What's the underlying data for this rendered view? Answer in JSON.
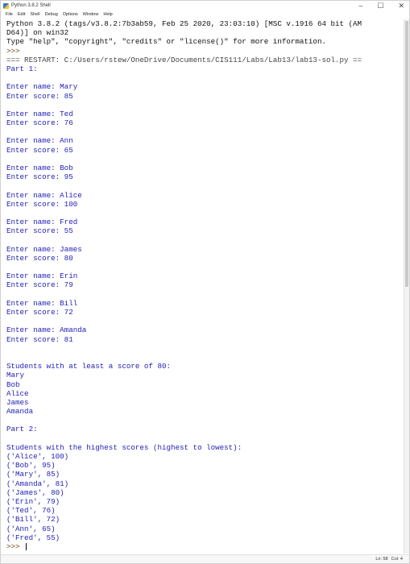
{
  "window": {
    "title": "Python 3.8.2 Shell",
    "icon": "python-icon",
    "controls": {
      "minimize": "–",
      "maximize": "☐",
      "close": "✕"
    }
  },
  "menu": [
    "File",
    "Edit",
    "Shell",
    "Debug",
    "Options",
    "Window",
    "Help"
  ],
  "shell_lines": [
    {
      "cls": "sys",
      "text": "Python 3.8.2 (tags/v3.8.2:7b3ab59, Feb 25 2020, 23:03:10) [MSC v.1916 64 bit (AM"
    },
    {
      "cls": "sys",
      "text": "D64)] on win32"
    },
    {
      "cls": "sys",
      "text": "Type \"help\", \"copyright\", \"credits\" or \"license()\" for more information."
    },
    {
      "cls": "prompt",
      "text": ">>> "
    },
    {
      "cls": "restart",
      "text": "=== RESTART: C:/Users/rstew/OneDrive/Documents/CIS111/Labs/Lab13/lab13-sol.py =="
    },
    {
      "cls": "out",
      "text": "Part 1:"
    },
    {
      "cls": "out",
      "text": ""
    },
    {
      "cls": "out",
      "text": "Enter name: Mary"
    },
    {
      "cls": "out",
      "text": "Enter score: 85"
    },
    {
      "cls": "out",
      "text": ""
    },
    {
      "cls": "out",
      "text": "Enter name: Ted"
    },
    {
      "cls": "out",
      "text": "Enter score: 76"
    },
    {
      "cls": "out",
      "text": ""
    },
    {
      "cls": "out",
      "text": "Enter name: Ann"
    },
    {
      "cls": "out",
      "text": "Enter score: 65"
    },
    {
      "cls": "out",
      "text": ""
    },
    {
      "cls": "out",
      "text": "Enter name: Bob"
    },
    {
      "cls": "out",
      "text": "Enter score: 95"
    },
    {
      "cls": "out",
      "text": ""
    },
    {
      "cls": "out",
      "text": "Enter name: Alice"
    },
    {
      "cls": "out",
      "text": "Enter score: 100"
    },
    {
      "cls": "out",
      "text": ""
    },
    {
      "cls": "out",
      "text": "Enter name: Fred"
    },
    {
      "cls": "out",
      "text": "Enter score: 55"
    },
    {
      "cls": "out",
      "text": ""
    },
    {
      "cls": "out",
      "text": "Enter name: James"
    },
    {
      "cls": "out",
      "text": "Enter score: 80"
    },
    {
      "cls": "out",
      "text": ""
    },
    {
      "cls": "out",
      "text": "Enter name: Erin"
    },
    {
      "cls": "out",
      "text": "Enter score: 79"
    },
    {
      "cls": "out",
      "text": ""
    },
    {
      "cls": "out",
      "text": "Enter name: Bill"
    },
    {
      "cls": "out",
      "text": "Enter score: 72"
    },
    {
      "cls": "out",
      "text": ""
    },
    {
      "cls": "out",
      "text": "Enter name: Amanda"
    },
    {
      "cls": "out",
      "text": "Enter score: 81"
    },
    {
      "cls": "out",
      "text": ""
    },
    {
      "cls": "out",
      "text": ""
    },
    {
      "cls": "out",
      "text": "Students with at least a score of 80:"
    },
    {
      "cls": "out",
      "text": "Mary"
    },
    {
      "cls": "out",
      "text": "Bob"
    },
    {
      "cls": "out",
      "text": "Alice"
    },
    {
      "cls": "out",
      "text": "James"
    },
    {
      "cls": "out",
      "text": "Amanda"
    },
    {
      "cls": "out",
      "text": ""
    },
    {
      "cls": "out",
      "text": "Part 2:"
    },
    {
      "cls": "out",
      "text": ""
    },
    {
      "cls": "out",
      "text": "Students with the highest scores (highest to lowest):"
    },
    {
      "cls": "out",
      "text": "('Alice', 100)"
    },
    {
      "cls": "out",
      "text": "('Bob', 95)"
    },
    {
      "cls": "out",
      "text": "('Mary', 85)"
    },
    {
      "cls": "out",
      "text": "('Amanda', 81)"
    },
    {
      "cls": "out",
      "text": "('James', 80)"
    },
    {
      "cls": "out",
      "text": "('Erin', 79)"
    },
    {
      "cls": "out",
      "text": "('Ted', 76)"
    },
    {
      "cls": "out",
      "text": "('Bill', 72)"
    },
    {
      "cls": "out",
      "text": "('Ann', 65)"
    },
    {
      "cls": "out",
      "text": "('Fred', 55)"
    },
    {
      "cls": "prompt",
      "text": ">>> ",
      "cursor": true
    }
  ],
  "status": {
    "line": "Ln: 58",
    "col": "Col: 4"
  }
}
